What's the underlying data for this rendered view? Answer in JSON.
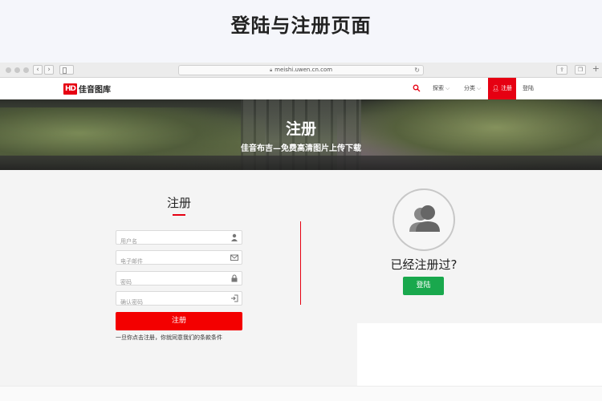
{
  "page_heading": "登陆与注册页面",
  "browser": {
    "url": "meishi.uwen.cn.com"
  },
  "site": {
    "logo_mark": "HD",
    "logo_text": "佳音图库",
    "nav": {
      "explore": "探索",
      "category": "分类",
      "register": "注册",
      "login": "登陆"
    },
    "hero": {
      "title": "注册",
      "subtitle": "佳音布吉—免费高清图片上传下载"
    },
    "form": {
      "title": "注册",
      "username_placeholder": "用户名",
      "email_placeholder": "电子邮件",
      "password_placeholder": "密码",
      "confirm_placeholder": "确认密码",
      "submit": "注册",
      "terms": "一旦你点击注册，你就同意我们的条款条件"
    },
    "login_panel": {
      "question": "已经注册过?",
      "button": "登陆"
    },
    "colors": {
      "brand_red": "#e60012",
      "login_green": "#19a84d"
    }
  }
}
